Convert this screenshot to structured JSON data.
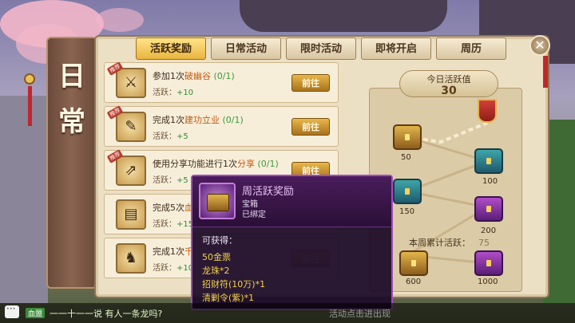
{
  "side_title": [
    "日",
    "常"
  ],
  "tabs": [
    {
      "label": "活跃奖励",
      "active": true
    },
    {
      "label": "日常活动",
      "active": false
    },
    {
      "label": "限时活动",
      "active": false
    },
    {
      "label": "即将开启",
      "active": false
    },
    {
      "label": "周历",
      "active": false
    }
  ],
  "tasks": [
    {
      "tag": "推荐",
      "pre": "参加1次",
      "hl": "破幽谷",
      "mid": "",
      "hl2": "",
      "prog": "(0/1)",
      "reward_label": "活跃：",
      "reward": "+10",
      "button": "前往"
    },
    {
      "tag": "推荐",
      "pre": "完成1次",
      "hl": "建功立业",
      "mid": "",
      "hl2": "",
      "prog": "(0/1)",
      "reward_label": "活跃：",
      "reward": "+5",
      "button": "前往"
    },
    {
      "tag": "推荐",
      "pre": "使用分享功能进行1次",
      "hl": "分享",
      "mid": "",
      "hl2": "",
      "prog": "(0/1)",
      "reward_label": "活跃：",
      "reward": "+5",
      "button": "前往"
    },
    {
      "tag": "",
      "pre": "完成5次",
      "hl": "血",
      "mid": "",
      "hl2": "",
      "prog": "",
      "reward_label": "活跃：",
      "reward": "+15",
      "button": ""
    },
    {
      "tag": "",
      "pre": "完成1次",
      "hl": "千",
      "mid": "",
      "hl2": "",
      "prog": "",
      "reward_label": "活跃：",
      "reward": "+10",
      "button": "前往"
    }
  ],
  "daily": {
    "label": "今日活跃值",
    "value": "30"
  },
  "chests": [
    {
      "value": "50"
    },
    {
      "value": "100"
    },
    {
      "value": "150"
    },
    {
      "value": "200"
    },
    {
      "value": "600"
    },
    {
      "value": "1000"
    }
  ],
  "weekly": {
    "label": "本周累计活跃：",
    "value": "75"
  },
  "tooltip": {
    "title": "周活跃奖励",
    "type": "宝箱",
    "bound": "已绑定",
    "obtain_label": "可获得：",
    "items": [
      "50金票",
      "龙珠*2",
      "招财符(10万)*1",
      "清剿令(紫)*1"
    ]
  },
  "chat": {
    "channel": "血盟",
    "text": "一一十一一说 有人一条龙吗?",
    "right": "活动点击进出现"
  },
  "colors": {
    "accent_gold": "#e9b540",
    "tooltip_border": "#a04fb7",
    "reward_green": "#2e8f2e"
  }
}
